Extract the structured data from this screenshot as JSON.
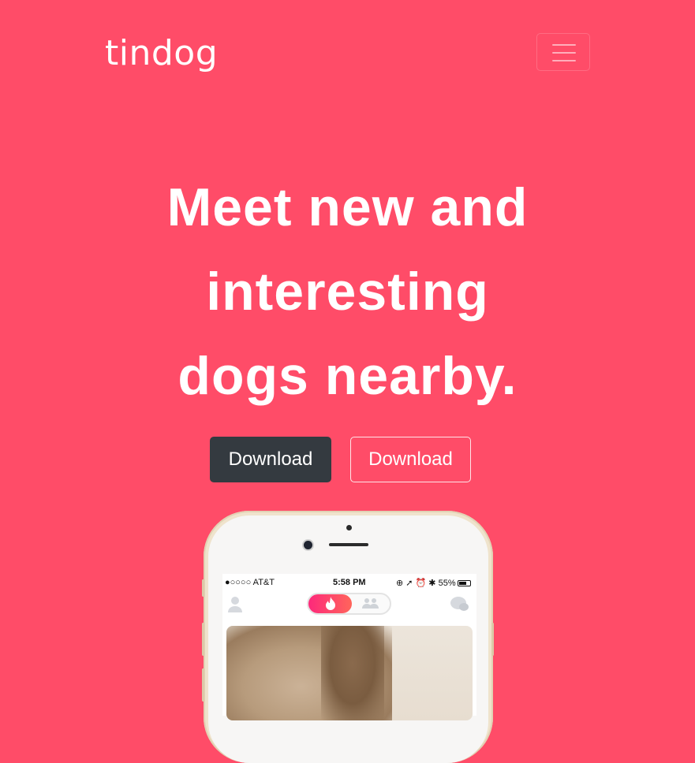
{
  "navbar": {
    "brand": "tindog",
    "toggler_icon": "hamburger-menu-icon"
  },
  "hero": {
    "headline_lines": [
      "Meet new and",
      "interesting",
      "dogs nearby."
    ],
    "buttons": {
      "primary_label": "Download",
      "secondary_label": "Download"
    }
  },
  "phone": {
    "status_bar": {
      "carrier": "●○○○○ AT&T",
      "time": "5:58 PM",
      "battery": "55%"
    },
    "app_toggle_left_icon": "flame-icon",
    "app_toggle_right_icon": "group-icon",
    "profile_icon": "user-icon",
    "chat_icon": "chat-bubbles-icon"
  },
  "colors": {
    "background": "#ff4c68",
    "dark_button": "#343a40",
    "text": "#ffffff"
  }
}
